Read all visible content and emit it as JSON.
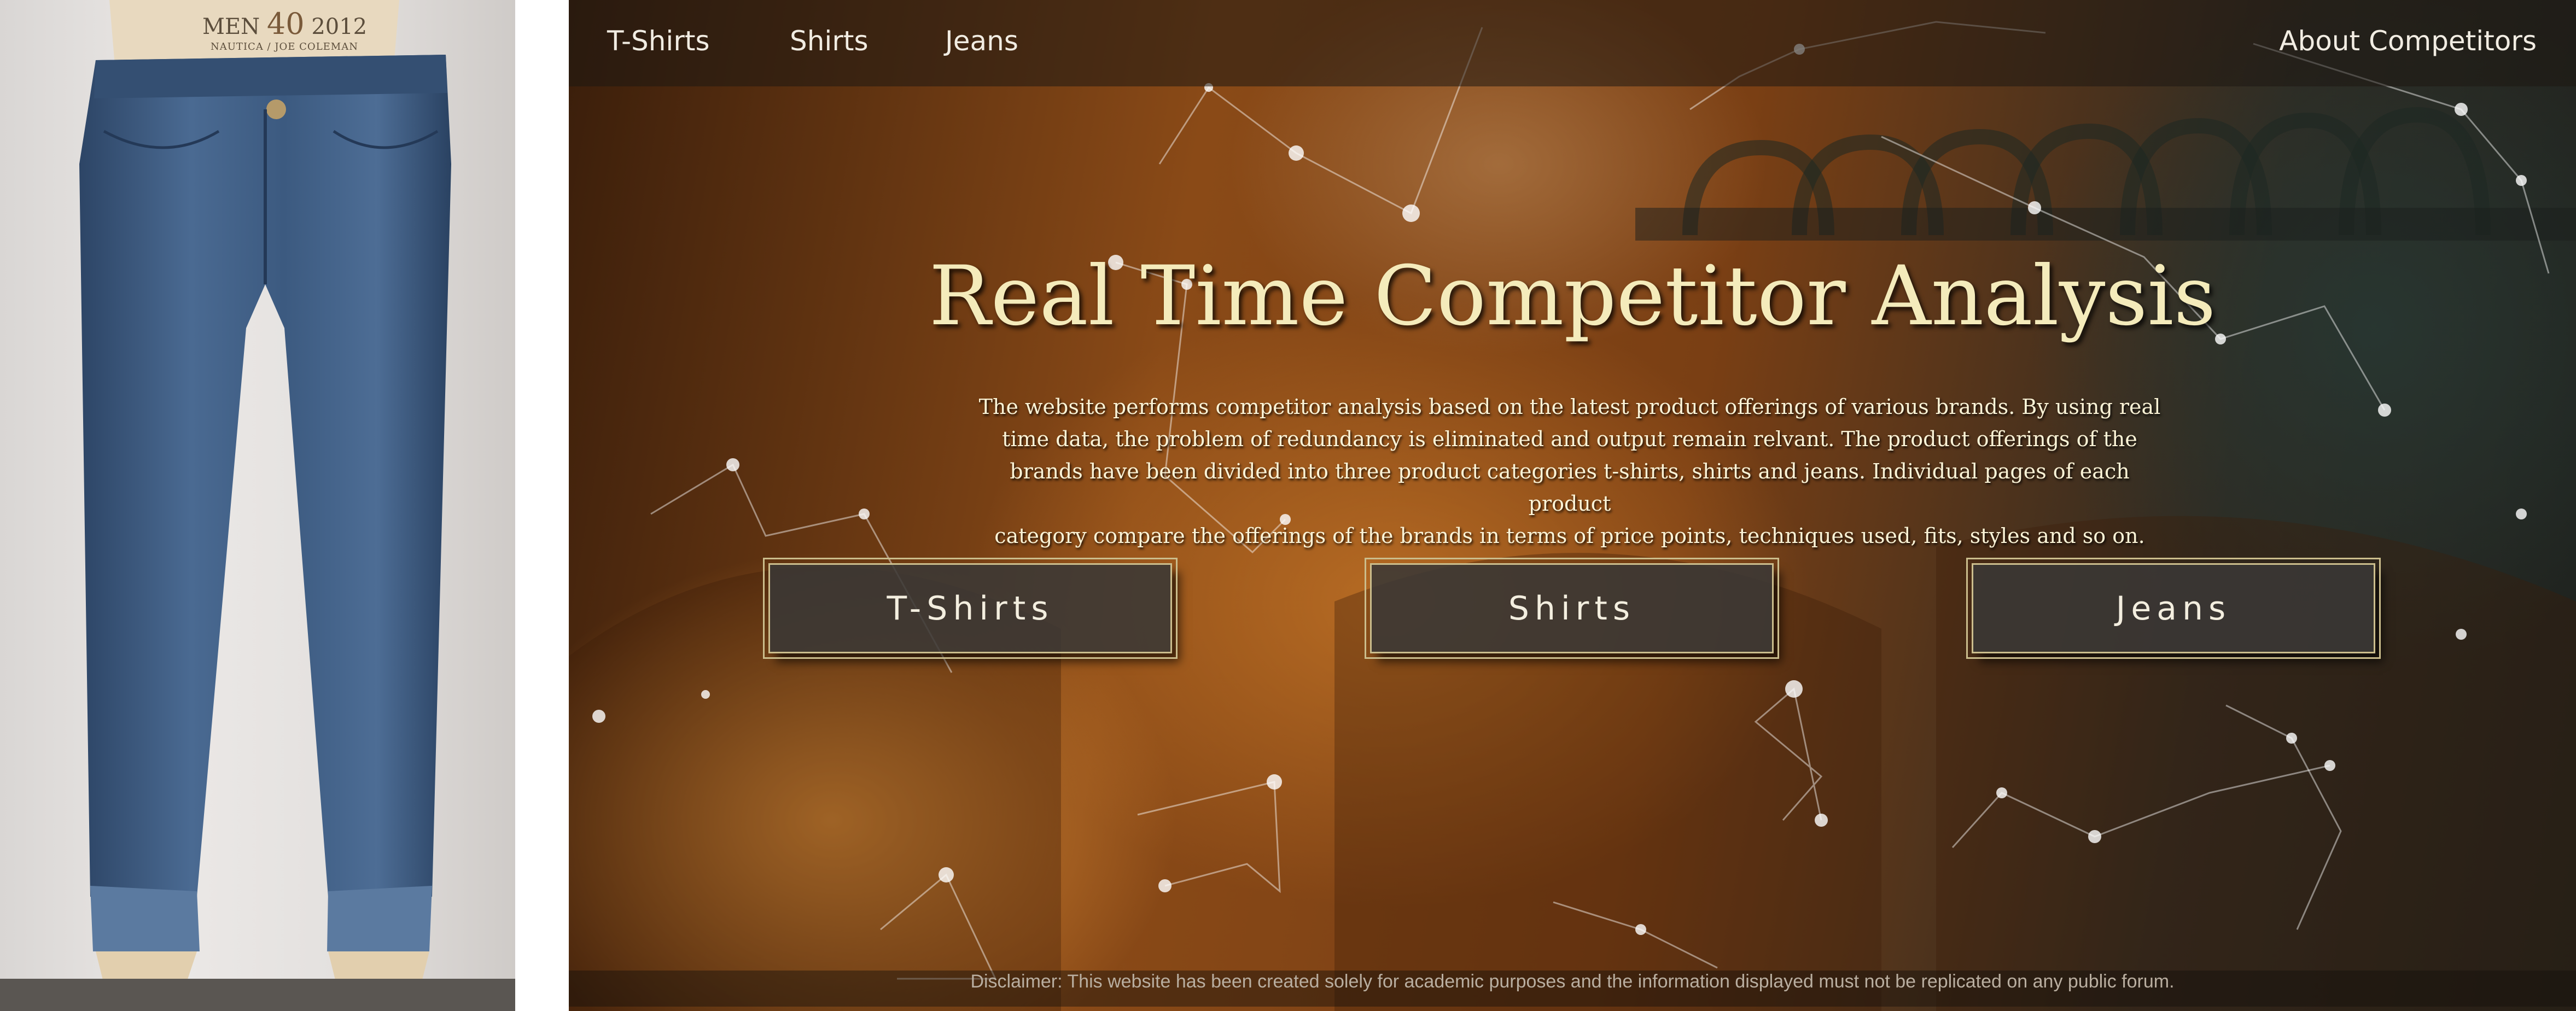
{
  "nav": {
    "links": [
      "T-Shirts",
      "Shirts",
      "Jeans"
    ],
    "about": "About Competitors"
  },
  "hero": {
    "title": "Real Time Competitor Analysis",
    "description_lines": [
      "The website performs competitor analysis based on the latest product offerings of various brands. By using real",
      "time data, the problem of redundancy is eliminated and output remain relvant. The product offerings of the",
      "brands have been divided into three product categories t-shirts, shirts and jeans. Individual pages of each product",
      "category compare the offerings of the brands in terms of price points, techniques used, fits, styles and so on."
    ],
    "buttons": [
      "T-Shirts",
      "Shirts",
      "Jeans"
    ]
  },
  "product_tag": {
    "line1_left": "MEN",
    "size": "40",
    "line1_right": "2012",
    "line2": "NAUTICA / JOE COLEMAN"
  },
  "footer": {
    "disclaimer": "Disclaimer: This website has been created solely for academic purposes and the information displayed must not be replicated on any public forum."
  },
  "colors": {
    "title": "#f4ebbb",
    "button_border": "#cbbd8c",
    "button_fill": "#3a3836",
    "jeans_denim": "#3e5b80"
  }
}
